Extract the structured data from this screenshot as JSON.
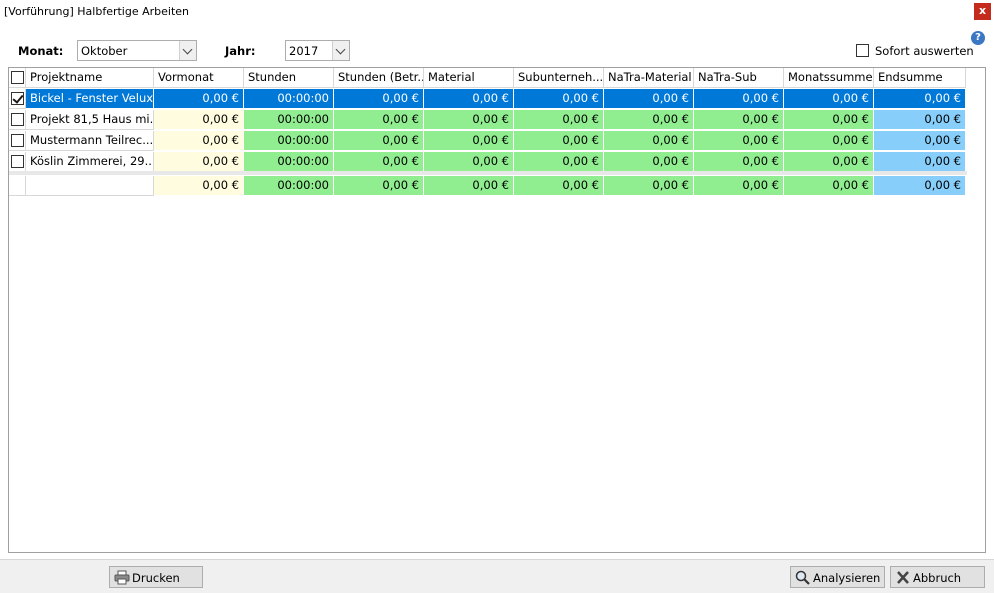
{
  "window": {
    "title": "[Vorführung] Halbfertige Arbeiten",
    "close_label": "x"
  },
  "filters": {
    "monat_label": "Monat:",
    "monat_value": "Oktober",
    "jahr_label": "Jahr:",
    "jahr_value": "2017",
    "sofort_label": "Sofort auswerten",
    "sofort_checked": false,
    "help_label": "?"
  },
  "table": {
    "columns": [
      "Projektname",
      "Vormonat",
      "Stunden",
      "Stunden (Betr...",
      "Material",
      "Subunterneh...",
      "NaTra-Material",
      "NaTra-Sub",
      "Monatssumme",
      "Endsumme"
    ],
    "rows": [
      {
        "checked": true,
        "selected": true,
        "cells": [
          "Bickel - Fenster Velux",
          "0,00 €",
          "00:00:00",
          "0,00 €",
          "0,00 €",
          "0,00 €",
          "0,00 €",
          "0,00 €",
          "0,00 €",
          "0,00 €"
        ]
      },
      {
        "checked": false,
        "selected": false,
        "cells": [
          "Projekt 81,5 Haus mi...",
          "0,00 €",
          "00:00:00",
          "0,00 €",
          "0,00 €",
          "0,00 €",
          "0,00 €",
          "0,00 €",
          "0,00 €",
          "0,00 €"
        ]
      },
      {
        "checked": false,
        "selected": false,
        "cells": [
          "Mustermann Teilrec...",
          "0,00 €",
          "00:00:00",
          "0,00 €",
          "0,00 €",
          "0,00 €",
          "0,00 €",
          "0,00 €",
          "0,00 €",
          "0,00 €"
        ]
      },
      {
        "checked": false,
        "selected": false,
        "cells": [
          "Köslin Zimmerei, 29...",
          "0,00 €",
          "00:00:00",
          "0,00 €",
          "0,00 €",
          "0,00 €",
          "0,00 €",
          "0,00 €",
          "0,00 €",
          "0,00 €"
        ]
      }
    ],
    "totals": [
      "",
      "0,00 €",
      "00:00:00",
      "0,00 €",
      "0,00 €",
      "0,00 €",
      "0,00 €",
      "0,00 €",
      "0,00 €",
      "0,00 €"
    ]
  },
  "buttons": {
    "print_label": "Drucken",
    "analyze_label": "Analysieren",
    "cancel_label": "Abbruch"
  },
  "colors": {
    "selection": "#0078d7",
    "vormonat": "#fffce0",
    "value_cells": "#90ee90",
    "endsumme": "#87cefa"
  },
  "icons": [
    "help-icon",
    "printer-icon",
    "magnifier-icon",
    "cancel-x-icon",
    "chevron-down-icon"
  ]
}
